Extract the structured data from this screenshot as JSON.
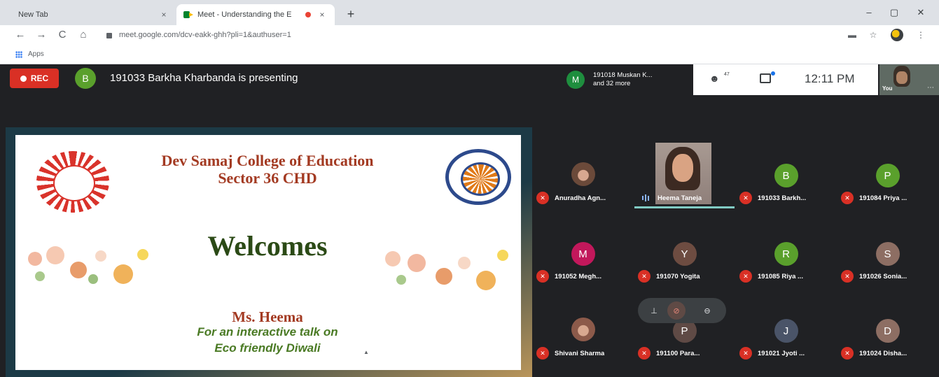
{
  "browser": {
    "tabs": [
      {
        "title": "New Tab",
        "close": "×"
      },
      {
        "title": "Meet - Understanding the E",
        "close": "×"
      }
    ],
    "new_tab": "+",
    "window_controls": {
      "minimize": "–",
      "maximize": "▢",
      "close": "✕"
    },
    "nav": {
      "back": "←",
      "forward": "→",
      "reload": "C",
      "home": "⌂"
    },
    "url": "meet.google.com/dcv-eakk-ghh?pli=1&authuser=1",
    "toolbar_icons": {
      "cast": "▬",
      "star": "☆",
      "menu": "⋮"
    },
    "bookmarks": {
      "apps_label": "Apps"
    }
  },
  "meet": {
    "rec_label": "REC",
    "presenter_initial": "B",
    "presenting_text": "191033 Barkha Kharbanda is presenting",
    "joined": {
      "initial": "M",
      "line1": "191018 Muskan K...",
      "line2": "and 32 more"
    },
    "people_count": "47",
    "time": "12:11 PM",
    "self_label": "You",
    "self_more": "⋯",
    "slide": {
      "college_line1": "Dev Samaj College of Education",
      "college_line2": "Sector 36 CHD",
      "welcome": "Welcomes",
      "speaker": "Ms. Heema",
      "talk_line1": "For an interactive talk on",
      "talk_line2": "Eco friendly Diwali"
    },
    "hover_controls": {
      "pin": "⊥",
      "mute": "⊘",
      "remove": "⊖"
    },
    "participants": [
      {
        "name": "Anuradha Agn...",
        "type": "photo",
        "color": "#6b4a3a"
      },
      {
        "name": "Heema Taneja",
        "type": "video",
        "speaking": true
      },
      {
        "name": "191033 Barkh...",
        "initial": "B",
        "color": "#5aa02c"
      },
      {
        "name": "191084 Priya ...",
        "initial": "P",
        "color": "#5aa02c"
      },
      {
        "name": "191052 Megh...",
        "initial": "M",
        "color": "#c2185b"
      },
      {
        "name": "191070 Yogita",
        "initial": "Y",
        "color": "#6d4c41"
      },
      {
        "name": "191085 Riya ...",
        "initial": "R",
        "color": "#5aa02c"
      },
      {
        "name": "191026 Sonia...",
        "initial": "S",
        "color": "#8d6e63"
      },
      {
        "name": "Shivani Sharma",
        "type": "photo",
        "color": "#8c5a4a"
      },
      {
        "name": "191100 Para...",
        "initial": "P",
        "color": "#5f4a45"
      },
      {
        "name": "191021 Jyoti ...",
        "initial": "J",
        "color": "#4a5468"
      },
      {
        "name": "191024 Disha...",
        "initial": "D",
        "color": "#8d6e63"
      }
    ]
  }
}
